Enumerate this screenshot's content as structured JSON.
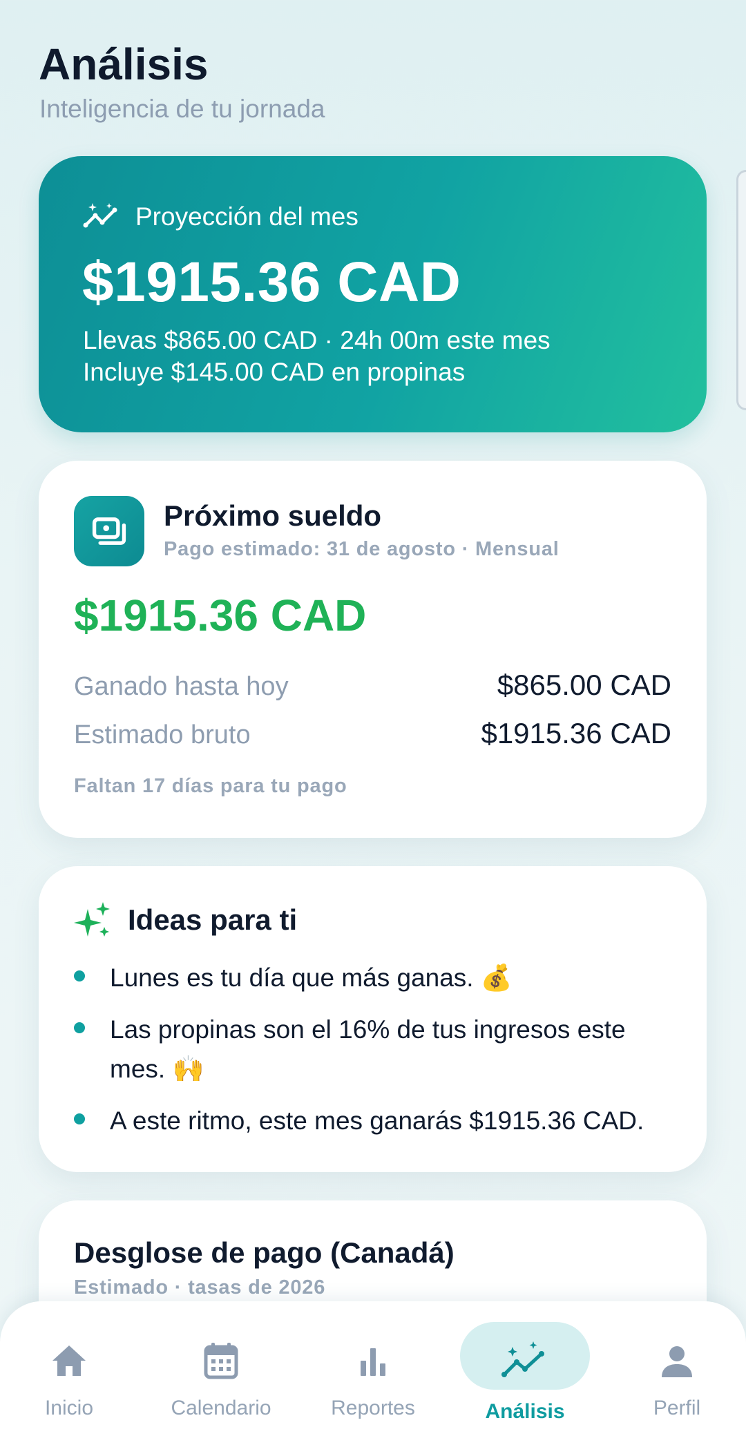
{
  "header": {
    "title": "Análisis",
    "subtitle": "Inteligencia de tu jornada"
  },
  "projection": {
    "label": "Proyección del mes",
    "icon": "sparkle-trend-icon",
    "value": "$1915.36 CAD",
    "line1": "Llevas $865.00 CAD · 24h 00m este mes",
    "line2": "Incluye $145.00 CAD en propinas"
  },
  "paycheck": {
    "icon": "cash-icon",
    "title": "Próximo sueldo",
    "subtitle": "Pago estimado: 31 de agosto · Mensual",
    "amount": "$1915.36 CAD",
    "rows": [
      {
        "label": "Ganado hasta hoy",
        "value": "$865.00 CAD"
      },
      {
        "label": "Estimado bruto",
        "value": "$1915.36 CAD"
      }
    ],
    "footer": "Faltan 17 días para tu pago"
  },
  "ideas": {
    "icon": "sparkles-icon",
    "title": "Ideas para ti",
    "items": [
      "Lunes es tu día que más ganas. 💰",
      "Las propinas son el 16% de tus ingresos este mes. 🙌",
      "A este ritmo, este mes ganarás $1915.36 CAD."
    ]
  },
  "breakdown": {
    "title": "Desglose de pago (Canadá)",
    "subtitle": "Estimado · tasas de 2026"
  },
  "nav": {
    "items": [
      {
        "label": "Inicio",
        "icon": "home-icon"
      },
      {
        "label": "Calendario",
        "icon": "calendar-icon"
      },
      {
        "label": "Reportes",
        "icon": "bar-chart-icon"
      },
      {
        "label": "Análisis",
        "icon": "trend-sparkle-icon",
        "active": true
      },
      {
        "label": "Perfil",
        "icon": "person-icon"
      }
    ]
  },
  "colors": {
    "accent": "#0fa0a0",
    "positive": "#1fb257",
    "muted": "#95a4b6",
    "text": "#101b2e"
  }
}
